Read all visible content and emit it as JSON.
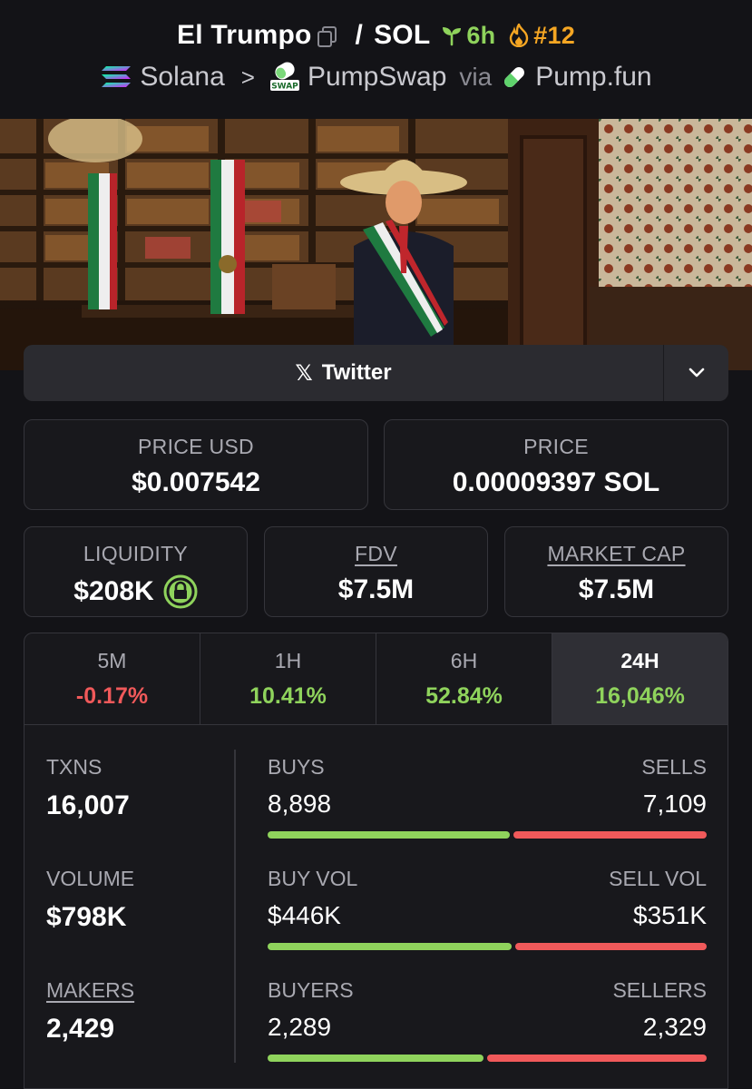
{
  "header": {
    "token_name": "El Trumpo",
    "quote": "SOL",
    "age": "6h",
    "rank": "#12",
    "chain": "Solana",
    "dex": "PumpSwap",
    "dex_icon_text": "SWAP",
    "via": "via",
    "launchpad": "Pump.fun"
  },
  "social": {
    "twitter_label": "Twitter"
  },
  "prices": {
    "price_usd_label": "PRICE USD",
    "price_usd": "$0.007542",
    "price_label": "PRICE",
    "price_sol": "0.00009397 SOL"
  },
  "metrics": {
    "liquidity_label": "LIQUIDITY",
    "liquidity": "$208K",
    "fdv_label": "FDV",
    "fdv": "$7.5M",
    "mcap_label": "MARKET CAP",
    "mcap": "$7.5M"
  },
  "tabs": [
    {
      "label": "5M",
      "value": "-0.17%",
      "trend": "neg"
    },
    {
      "label": "1H",
      "value": "10.41%",
      "trend": "pos"
    },
    {
      "label": "6H",
      "value": "52.84%",
      "trend": "pos"
    },
    {
      "label": "24H",
      "value": "16,046%",
      "trend": "pos",
      "active": true
    }
  ],
  "stats": {
    "txns_label": "TXNS",
    "txns": "16,007",
    "volume_label": "VOLUME",
    "volume": "$798K",
    "makers_label": "MAKERS",
    "makers": "2,429",
    "buys_label": "BUYS",
    "buys": "8,898",
    "sells_label": "SELLS",
    "sells": "7,109",
    "buy_share": 0.556,
    "buy_vol_label": "BUY VOL",
    "buy_vol": "$446K",
    "sell_vol_label": "SELL VOL",
    "sell_vol": "$351K",
    "buy_vol_share": 0.56,
    "buyers_label": "BUYERS",
    "buyers": "2,289",
    "sellers_label": "SELLERS",
    "sellers": "2,329",
    "buyers_share": 0.496
  },
  "colors": {
    "positive": "#8fd35c",
    "negative": "#f0595a",
    "rank": "#f5a623"
  }
}
